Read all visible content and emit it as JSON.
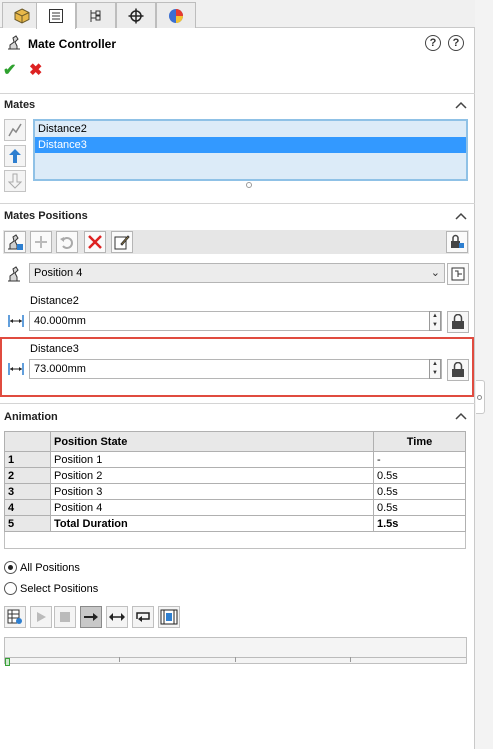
{
  "tabs": [
    {
      "name": "FeatureManager",
      "icon": "cube-icon"
    },
    {
      "name": "PropertyManager",
      "icon": "property-manager-icon"
    },
    {
      "name": "ConfigurationManager",
      "icon": "configuration-icon"
    },
    {
      "name": "DimXpertManager",
      "icon": "crosshair-icon"
    },
    {
      "name": "DisplayManager",
      "icon": "display-pie-icon"
    }
  ],
  "header": {
    "title": "Mate Controller"
  },
  "sections": {
    "mates": {
      "title": "Mates",
      "items": [
        {
          "label": "Distance2",
          "selected": false
        },
        {
          "label": "Distance3",
          "selected": true
        }
      ]
    },
    "positions": {
      "title": "Mates Positions",
      "selected_position": "Position 4",
      "fields": [
        {
          "label": "Distance2",
          "value": "40.000mm"
        },
        {
          "label": "Distance3",
          "value": "73.000mm"
        }
      ]
    },
    "animation": {
      "title": "Animation",
      "columns": [
        "",
        "Position State",
        "Time"
      ],
      "rows": [
        {
          "idx": "1",
          "state": "Position 1",
          "time": "-"
        },
        {
          "idx": "2",
          "state": "Position 2",
          "time": "0.5s"
        },
        {
          "idx": "3",
          "state": "Position 3",
          "time": "0.5s"
        },
        {
          "idx": "4",
          "state": "Position 4",
          "time": "0.5s"
        },
        {
          "idx": "5",
          "state": "Total Duration",
          "time": "1.5s"
        }
      ],
      "radio_all": "All Positions",
      "radio_select": "Select Positions",
      "selected_radio": "All Positions"
    }
  },
  "colors": {
    "accent": "#3399ff",
    "highlight_border": "#e04b3f",
    "ok": "#2fa12f",
    "cancel": "#dd2222"
  }
}
